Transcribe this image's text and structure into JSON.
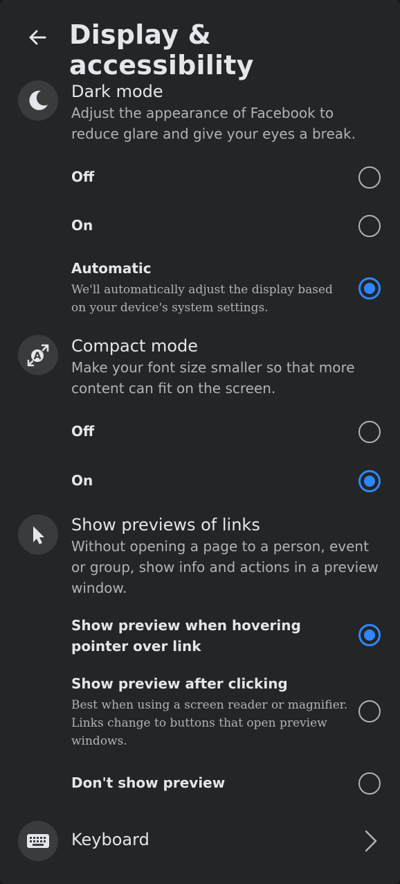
{
  "header": {
    "title": "Display & accessibility"
  },
  "dark_mode": {
    "title": "Dark mode",
    "description": "Adjust the appearance of Facebook to reduce glare and give your eyes a break.",
    "options": [
      {
        "label": "Off",
        "selected": false
      },
      {
        "label": "On",
        "selected": false
      },
      {
        "label": "Automatic",
        "sublabel": "We'll automatically adjust the display based on your device's system settings.",
        "selected": true
      }
    ]
  },
  "compact_mode": {
    "title": "Compact mode",
    "description": "Make your font size smaller so that more content can fit on the screen.",
    "options": [
      {
        "label": "Off",
        "selected": false
      },
      {
        "label": "On",
        "selected": true
      }
    ]
  },
  "link_previews": {
    "title": "Show previews of links",
    "description": "Without opening a page to a person, event or group, show info and actions in a preview window.",
    "options": [
      {
        "label": "Show preview when hovering pointer over link",
        "selected": true
      },
      {
        "label": "Show preview after clicking",
        "sublabel": "Best when using a screen reader or magnifier. Links change to buttons that open preview windows.",
        "selected": false
      },
      {
        "label": "Don't show preview",
        "selected": false
      }
    ]
  },
  "keyboard": {
    "label": "Keyboard"
  },
  "colors": {
    "background": "#242526",
    "accent": "#2d88ff",
    "primary_text": "#e4e6eb",
    "secondary_text": "#b0b3b8",
    "icon_circle": "#3a3b3c"
  }
}
